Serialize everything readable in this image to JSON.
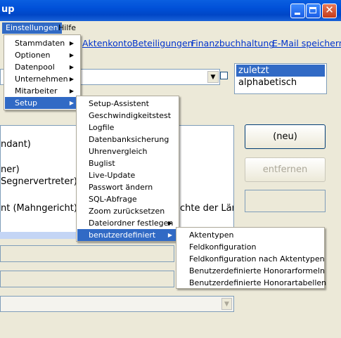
{
  "window": {
    "title": "up"
  },
  "menubar": {
    "einstellungen": "Einstellungen",
    "hilfe": "Hilfe"
  },
  "links": [
    "Aktenkonto",
    "Beteiligungen",
    "Finanzbuchhaltung",
    "E-Mail speichern"
  ],
  "sort_list": [
    "zuletzt",
    "alphabetisch"
  ],
  "main_list": {
    "lines": [
      "ndant)",
      "ner)",
      "Segnervertreter)",
      "nt (Mahngericht) -",
      "chte der Län"
    ]
  },
  "buttons": {
    "neu": "(neu)",
    "entfernen": "entfernen"
  },
  "menu_einstellungen": {
    "items": [
      {
        "label": "Stammdaten",
        "submenu": true
      },
      {
        "label": "Optionen",
        "submenu": true
      },
      {
        "label": "Datenpool",
        "submenu": true
      },
      {
        "label": "Unternehmen",
        "submenu": true
      },
      {
        "label": "Mitarbeiter",
        "submenu": true
      },
      {
        "label": "Setup",
        "submenu": true,
        "selected": true
      }
    ]
  },
  "menu_setup": {
    "items": [
      {
        "label": "Setup-Assistent"
      },
      {
        "label": "Geschwindigkeitstest"
      },
      {
        "label": "Logfile"
      },
      {
        "label": "Datenbanksicherung"
      },
      {
        "label": "Uhrenvergleich"
      },
      {
        "label": "Buglist"
      },
      {
        "label": "Live-Update"
      },
      {
        "label": "Passwort ändern"
      },
      {
        "label": "SQL-Abfrage"
      },
      {
        "label": "Zoom zurücksetzen"
      },
      {
        "label": "Dateiordner festlegen",
        "submenu": true
      },
      {
        "label": "benutzerdefiniert",
        "submenu": true,
        "selected": true
      }
    ]
  },
  "menu_benutzerdefiniert": {
    "items": [
      {
        "label": "Aktentypen"
      },
      {
        "label": "Feldkonfiguration"
      },
      {
        "label": "Feldkonfiguration nach Aktentypen"
      },
      {
        "label": "Benutzerdefinierte Honorarformeln"
      },
      {
        "label": "Benutzerdefinierte Honorartabellen"
      }
    ]
  },
  "icons": {
    "submenu_arrow": "triangle-right",
    "dropdown_arrow": "triangle-down"
  },
  "colors": {
    "titlebar": "#0054e3",
    "highlight": "#316ac5",
    "link": "#0033cc",
    "face": "#ece9d8"
  }
}
